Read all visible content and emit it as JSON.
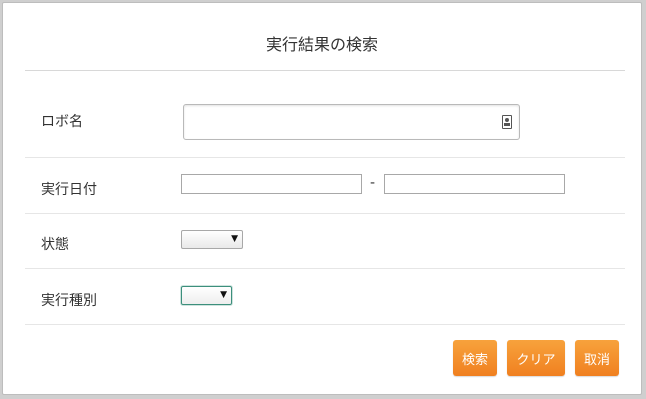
{
  "dialog": {
    "title": "実行結果の検索"
  },
  "form": {
    "robot_name_label": "ロボ名",
    "robot_name_value": "",
    "exec_date_label": "実行日付",
    "exec_date_from": "",
    "date_separator": "-",
    "exec_date_to": "",
    "status_label": "状態",
    "status_value": "",
    "exec_type_label": "実行種別",
    "exec_type_value": ""
  },
  "buttons": {
    "search": "検索",
    "clear": "クリア",
    "cancel": "取消"
  },
  "colors": {
    "accent": "#f08a24",
    "focus": "#3c8f7c"
  }
}
